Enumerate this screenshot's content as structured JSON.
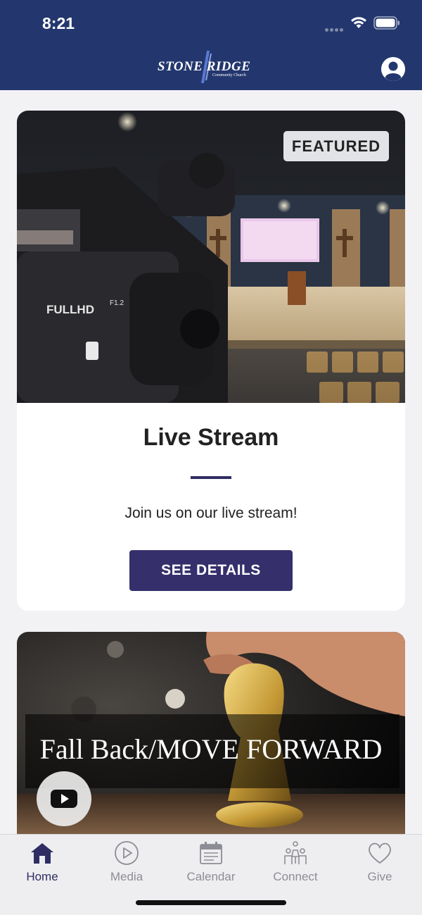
{
  "status_bar": {
    "time": "8:21"
  },
  "header": {
    "logo_text": "STONE  RIDGE",
    "logo_subtext": "Community Church",
    "profile_icon": "user-circle-icon"
  },
  "featured_card": {
    "badge": "FEATURED",
    "title": "Live Stream",
    "description": "Join us on our live stream!",
    "button_label": "SEE DETAILS"
  },
  "media_card": {
    "title": "Fall Back/MOVE FORWARD",
    "play_icon": "youtube-play-icon"
  },
  "tabbar": {
    "tabs": [
      {
        "label": "Home",
        "icon": "home-icon",
        "active": true
      },
      {
        "label": "Media",
        "icon": "play-circle-icon",
        "active": false
      },
      {
        "label": "Calendar",
        "icon": "calendar-icon",
        "active": false
      },
      {
        "label": "Connect",
        "icon": "people-icon",
        "active": false
      },
      {
        "label": "Give",
        "icon": "heart-icon",
        "active": false
      }
    ]
  },
  "colors": {
    "header_bg": "#23376e",
    "accent": "#352f6c",
    "tab_active": "#2f2d63",
    "tab_inactive": "#8d8d95"
  }
}
